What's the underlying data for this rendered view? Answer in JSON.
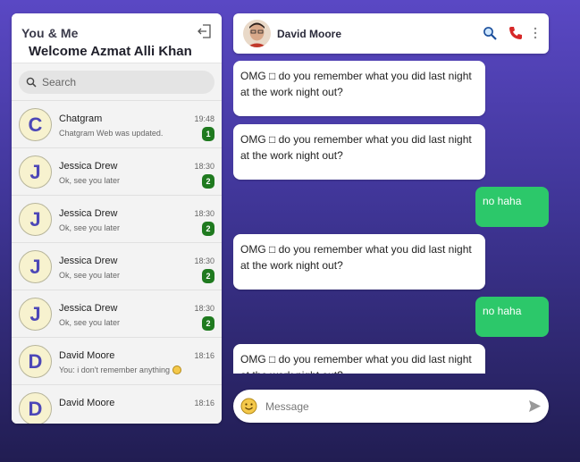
{
  "sidebar": {
    "app_name": "You & Me",
    "welcome": "Welcome Azmat Alli Khan",
    "search_placeholder": "Search",
    "chats": [
      {
        "initial": "C",
        "name": "Chatgram",
        "preview": "Chatgram Web was updated.",
        "time": "19:48",
        "unread": "1"
      },
      {
        "initial": "J",
        "name": "Jessica Drew",
        "preview": "Ok, see you later",
        "time": "18:30",
        "unread": "2"
      },
      {
        "initial": "J",
        "name": "Jessica Drew",
        "preview": "Ok, see you later",
        "time": "18:30",
        "unread": "2"
      },
      {
        "initial": "J",
        "name": "Jessica Drew",
        "preview": "Ok, see you later",
        "time": "18:30",
        "unread": "2"
      },
      {
        "initial": "J",
        "name": "Jessica Drew",
        "preview": "Ok, see you later",
        "time": "18:30",
        "unread": "2"
      },
      {
        "initial": "D",
        "name": "David Moore",
        "preview": "You: i don't remember anything",
        "time": "18:16",
        "unread": ""
      },
      {
        "initial": "D",
        "name": "David Moore",
        "preview": "",
        "time": "18:16",
        "unread": ""
      }
    ]
  },
  "header": {
    "contact_name": "David Moore"
  },
  "messages": [
    {
      "dir": "in",
      "text": "OMG □ do you remember what you did last night at the work night out?"
    },
    {
      "dir": "in",
      "text": "OMG □ do you remember what you did last night at the work night out?"
    },
    {
      "dir": "out",
      "text": "no haha"
    },
    {
      "dir": "in",
      "text": "OMG □ do you remember what you did last night at the work night out?"
    },
    {
      "dir": "out",
      "text": "no haha"
    },
    {
      "dir": "in",
      "text": "OMG □ do you remember what you did last night at the work night out?"
    }
  ],
  "composer": {
    "placeholder": "Message"
  },
  "icons": {
    "logout": "logout-icon",
    "search": "search-icon",
    "call": "phone-icon",
    "more": "more-vertical-icon",
    "emoji": "emoji-icon",
    "send": "send-icon"
  },
  "colors": {
    "outgoing_bubble": "#2cc86a",
    "unread_badge": "#1f7a1f",
    "avatar_letter": "#4c47b7",
    "call_icon": "#d62828"
  }
}
